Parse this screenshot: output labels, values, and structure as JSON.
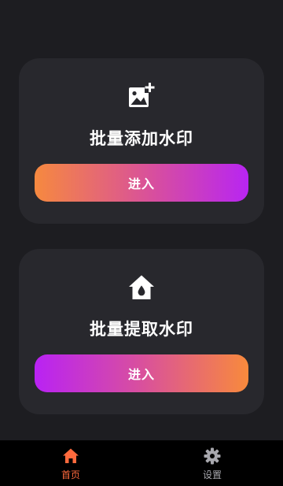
{
  "cards": [
    {
      "title": "批量添加水印",
      "button_label": "进入",
      "icon": "add-image-icon"
    },
    {
      "title": "批量提取水印",
      "button_label": "进入",
      "icon": "home-drop-icon"
    }
  ],
  "nav": {
    "items": [
      {
        "label": "首页",
        "icon": "home-icon",
        "active": true
      },
      {
        "label": "设置",
        "icon": "gear-icon",
        "active": false
      }
    ]
  },
  "colors": {
    "background": "#1d1d21",
    "card": "#28282d",
    "gradient_orange": "#f6893f",
    "gradient_purple": "#b825f2",
    "nav_active": "#ff6a3d",
    "nav_inactive": "#a7a7ad"
  }
}
